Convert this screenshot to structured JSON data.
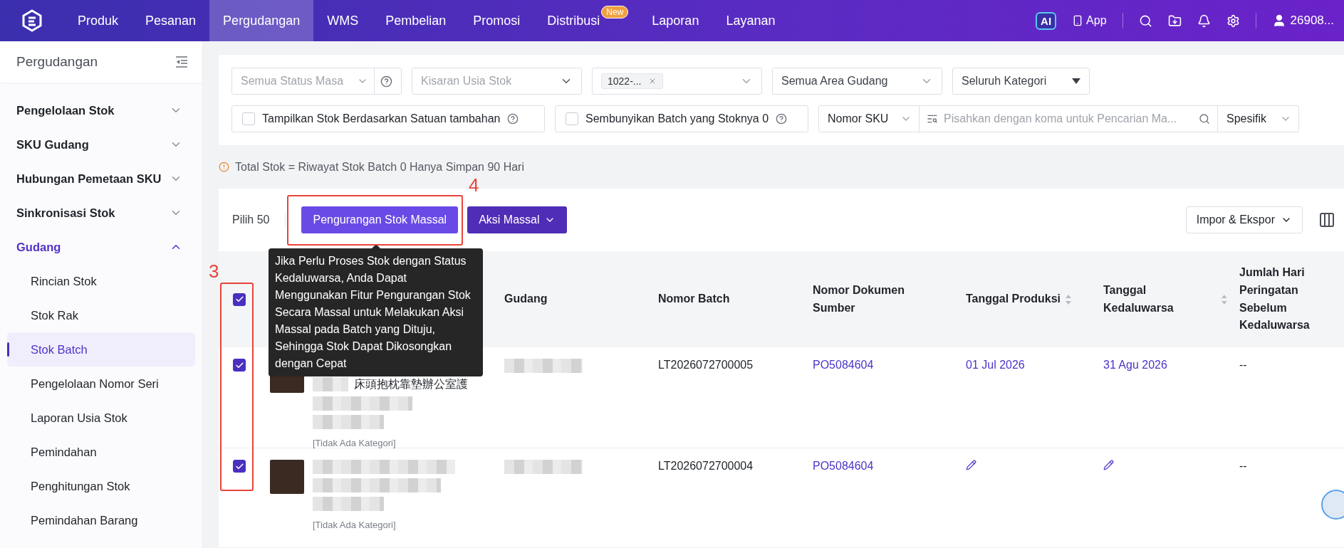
{
  "nav": {
    "items": [
      {
        "label": "Produk",
        "selected": false
      },
      {
        "label": "Pesanan",
        "selected": false
      },
      {
        "label": "Pergudangan",
        "selected": true
      },
      {
        "label": "WMS",
        "selected": false
      },
      {
        "label": "Pembelian",
        "selected": false
      },
      {
        "label": "Promosi",
        "selected": false
      },
      {
        "label": "Distribusi",
        "selected": false,
        "badge": "New"
      },
      {
        "label": "Laporan",
        "selected": false
      },
      {
        "label": "Layanan",
        "selected": false
      }
    ],
    "ai_badge": "AI",
    "app_label": "App",
    "user": "26908..."
  },
  "sidebar": {
    "title": "Pergudangan",
    "groups": [
      {
        "label": "Pengelolaan Stok",
        "expanded": false
      },
      {
        "label": "SKU Gudang",
        "expanded": false
      },
      {
        "label": "Hubungan Pemetaan SKU",
        "expanded": false
      },
      {
        "label": "Sinkronisasi Stok",
        "expanded": false
      },
      {
        "label": "Gudang",
        "expanded": true,
        "children": [
          {
            "label": "Rincian Stok",
            "selected": false
          },
          {
            "label": "Stok Rak",
            "selected": false
          },
          {
            "label": "Stok Batch",
            "selected": true
          },
          {
            "label": "Pengelolaan Nomor Seri",
            "selected": false
          },
          {
            "label": "Laporan Usia Stok",
            "selected": false
          },
          {
            "label": "Pemindahan",
            "selected": false
          },
          {
            "label": "Penghitungan Stok",
            "selected": false
          },
          {
            "label": "Pemindahan Barang",
            "selected": false
          }
        ]
      }
    ]
  },
  "filters": {
    "selects": [
      {
        "kind": "help",
        "placeholder": "Semua Status Masa"
      },
      {
        "kind": "plain",
        "placeholder": "Kisaran Usia Stok"
      },
      {
        "kind": "tags",
        "tag": "1022-..."
      },
      {
        "kind": "plain",
        "value": "Semua Area Gudang"
      },
      {
        "kind": "solid",
        "value": "Seluruh Kategori"
      }
    ],
    "checkboxes": [
      {
        "label": "Tampilkan Stok Berdasarkan Satuan tambahan",
        "checked": false
      },
      {
        "label": "Sembunyikan Batch yang Stoknya 0",
        "checked": false
      }
    ],
    "search": {
      "field": "Nomor SKU",
      "placeholder": "Pisahkan dengan koma untuk Pencarian Ma...",
      "mode": "Spesifik"
    }
  },
  "note": "Total Stok = Riwayat Stok Batch 0 Hanya Simpan 90 Hari",
  "toolbar": {
    "selected_count": "Pilih 50",
    "buttons": [
      {
        "label": "Pengurangan Stok Massal",
        "kind": "primary"
      },
      {
        "label": "Aksi Massal",
        "kind": "dropdown"
      }
    ],
    "import_export": "Impor & Ekspor"
  },
  "tooltip": "Jika Perlu Proses Stok dengan Status Kedaluwarsa, Anda Dapat Menggunakan Fitur Pengurangan Stok Secara Massal untuk Melakukan Aksi Massal pada Batch yang Dituju, Sehingga Stok Dapat Dikosongkan dengan Cepat",
  "table": {
    "all_selected": true,
    "columns": [
      {
        "label": "Gudang",
        "sortable": false
      },
      {
        "label": "Nomor Batch",
        "sortable": false
      },
      {
        "label": "Nomor Dokumen Sumber",
        "sortable": false
      },
      {
        "label": "Tanggal Produksi",
        "sortable": true
      },
      {
        "label": "Tanggal Kedaluwarsa",
        "sortable": true
      },
      {
        "label": "Jumlah Hari Peringatan Sebelum Kedaluwarsa",
        "sortable": false
      }
    ],
    "rows": [
      {
        "selected": true,
        "product_name": "床頭抱枕靠墊辦公室護",
        "category": "[Tidak Ada Kategori]",
        "batch": "LT2026072700005",
        "source_doc": "PO5084604",
        "production_date": "01 Jul 2026",
        "expiry_date": "31 Agu 2026",
        "warning_days": "--"
      },
      {
        "selected": true,
        "category": "[Tidak Ada Kategori]",
        "batch": "LT2026072700004",
        "source_doc": "PO5084604",
        "warning_days": "--"
      }
    ]
  },
  "annotations": [
    {
      "label": "4"
    },
    {
      "label": "3"
    }
  ]
}
